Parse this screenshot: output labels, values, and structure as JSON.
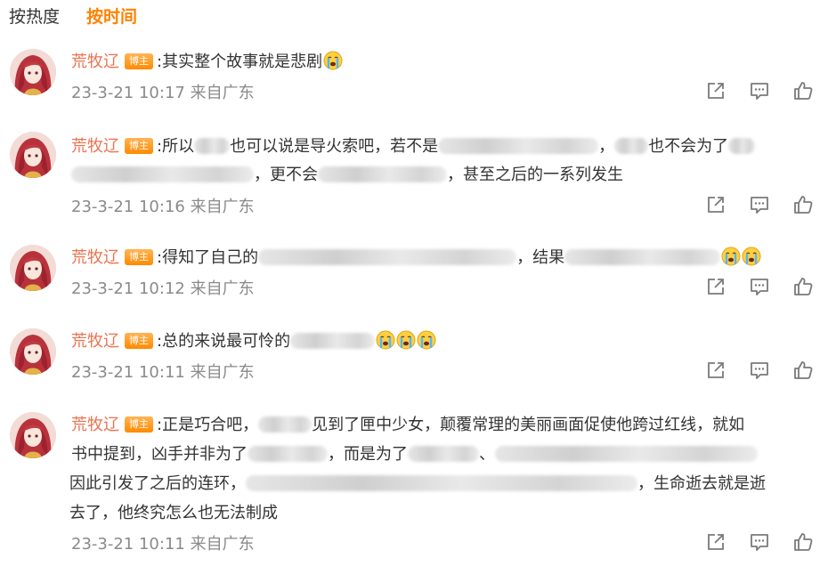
{
  "tabs": [
    {
      "label": "按热度",
      "active": false
    },
    {
      "label": "按时间",
      "active": true
    }
  ],
  "badge_label": "博主",
  "author": "荒牧辽",
  "colors": {
    "accent": "#ff8200",
    "name": "#eb7350",
    "meta": "#8a8a8a"
  },
  "icons": [
    "share-icon",
    "comment-icon",
    "like-icon",
    "crying-emoji"
  ],
  "comments": [
    {
      "text_parts": [
        ":其实整个故事就是悲剧"
      ],
      "time": "23-3-21 10:17",
      "location": "来自广东"
    },
    {
      "text_parts": [
        ":所以",
        "也可以说是导火索吧，若不是",
        "，",
        "也不会为了",
        "，更不会",
        "，甚至之后的一系列发生"
      ],
      "time": "23-3-21 10:16",
      "location": "来自广东"
    },
    {
      "text_parts": [
        ":得知了自己的",
        "，结果"
      ],
      "time": "23-3-21 10:12",
      "location": "来自广东"
    },
    {
      "text_parts": [
        ":总的来说最可怜的"
      ],
      "time": "23-3-21 10:11",
      "location": "来自广东"
    },
    {
      "text_parts": [
        ":正是巧合吧，",
        "见到了匣中少女，颠覆常理的美丽画面促使他跨过红线，就如",
        "书中提到，凶手并非为了",
        "，而是为了",
        "、",
        "因此引发了之后的连环，",
        "，生命逝去就是逝",
        "去了，他终究怎么也无法制成"
      ],
      "time": "23-3-21 10:11",
      "location": "来自广东"
    }
  ]
}
